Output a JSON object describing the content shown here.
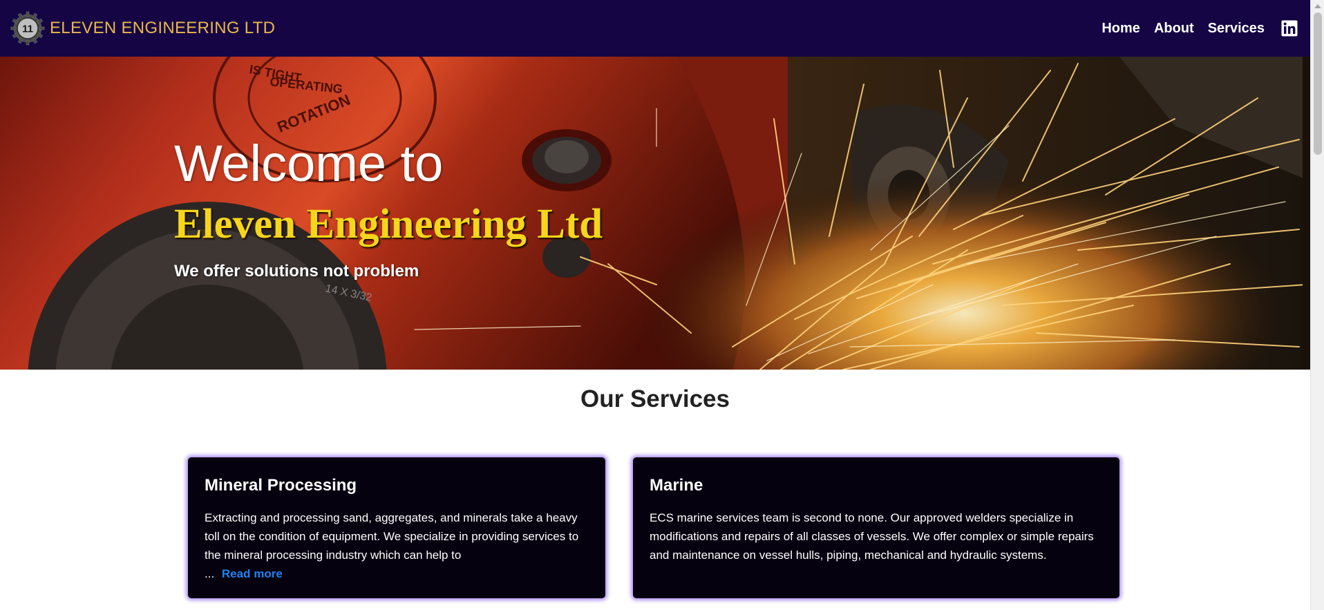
{
  "header": {
    "brand_name": "ELEVEN ENGINEERING LTD",
    "logo_text": "11",
    "nav": [
      {
        "label": "Home"
      },
      {
        "label": "About"
      },
      {
        "label": "Services"
      }
    ],
    "social_icon": "linkedin-icon"
  },
  "hero": {
    "welcome": "Welcome to",
    "company": "Eleven Engineering Ltd",
    "tagline": "We offer solutions not problem",
    "background_labels": [
      "IS TIGHT",
      "OPERATING",
      "ROTATION",
      "14 X 3/32"
    ]
  },
  "services": {
    "title": "Our Services",
    "cards": [
      {
        "title": "Mineral Processing",
        "text": "Extracting and processing sand, aggregates, and minerals take a heavy toll on the condition of equipment. We specialize in providing services to the mineral processing industry which can help to",
        "ellipsis": "...",
        "read_more": "Read more"
      },
      {
        "title": "Marine",
        "text": "ECS marine services team is second to none. Our approved welders specialize in modifications and repairs of all classes of vessels. We offer complex or simple repairs and maintenance on vessel hulls, piping, mechanical and hydraulic systems."
      }
    ]
  },
  "colors": {
    "navbar_bg": "#150545",
    "brand": "#e8b84a",
    "hero_company": "#f6d61a",
    "card_bg": "#05010f",
    "card_glow": "#966ef0",
    "link": "#1e82f0"
  }
}
